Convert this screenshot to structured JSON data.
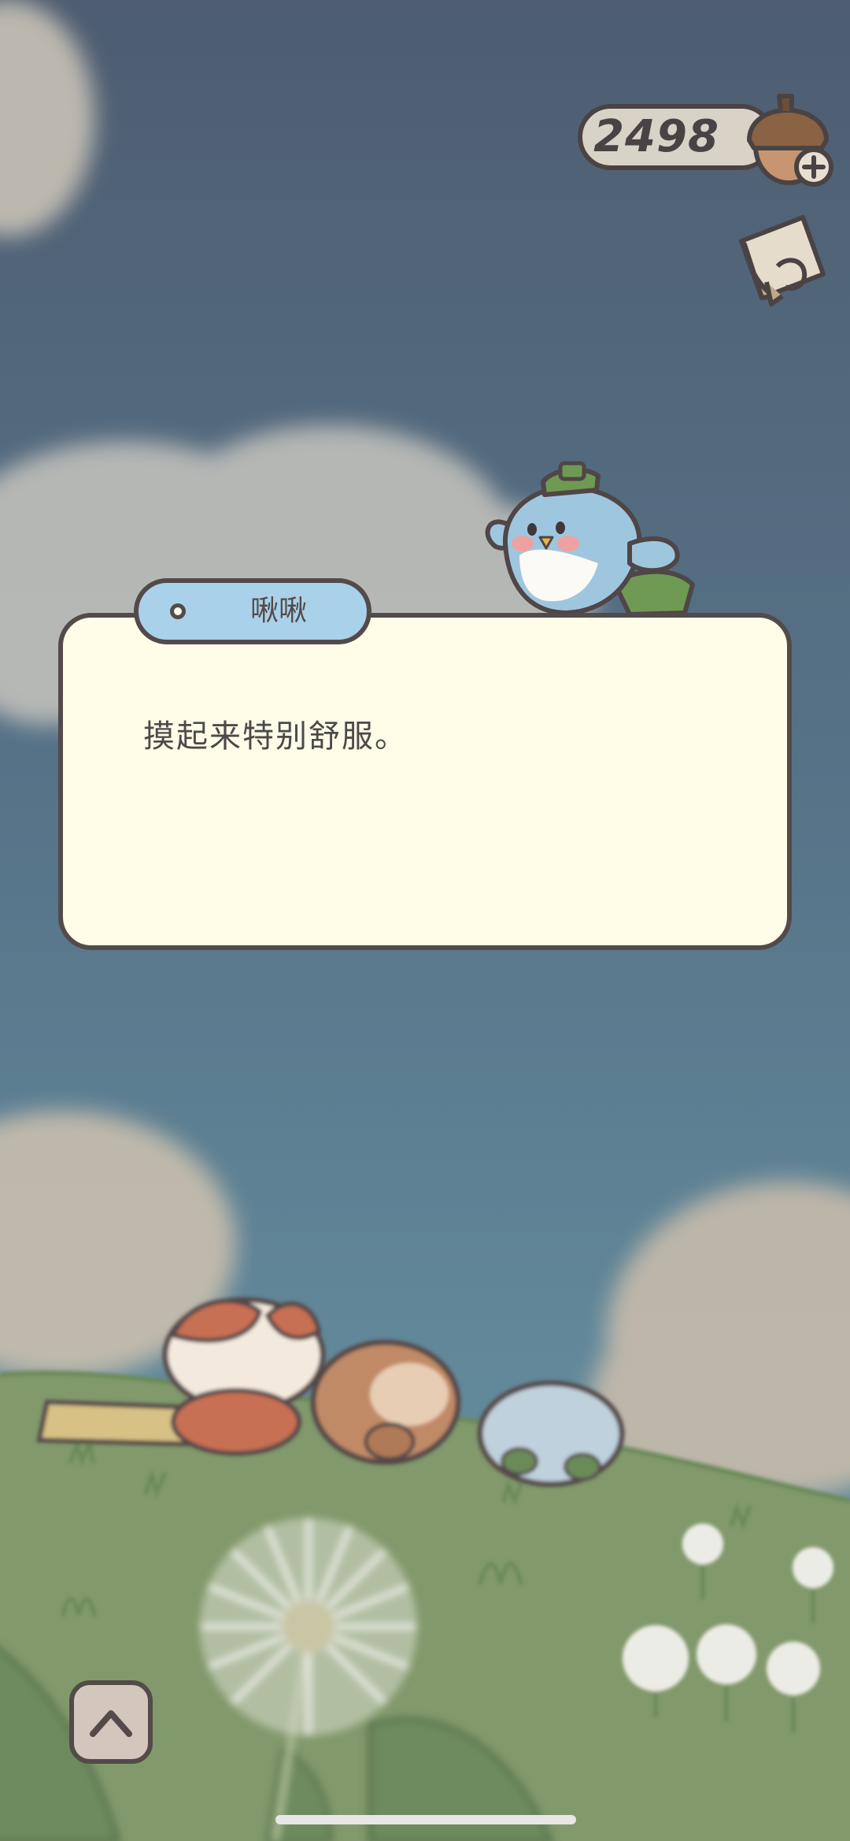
{
  "hud": {
    "acorn_count": "2498",
    "currency_icon": "acorn-plus-icon",
    "journal_icon": "letter-icon"
  },
  "dialog": {
    "speaker": "啾啾",
    "message": "摸起来特别舒服。"
  },
  "controls": {
    "expand_icon": "chevron-up-icon"
  },
  "colors": {
    "sky_top": "#4f5f72",
    "sky_bottom": "#648c99",
    "grass": "#7f9a6a",
    "dialog_bg": "#fffce8",
    "name_tab_bg": "#a9d1e9",
    "outline": "#534a4a"
  }
}
